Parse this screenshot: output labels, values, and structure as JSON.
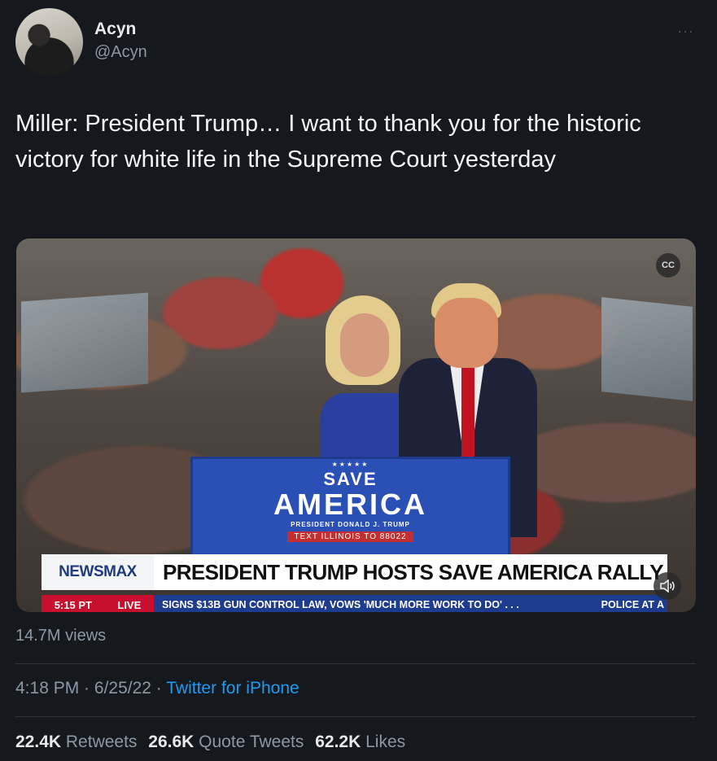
{
  "author": {
    "name": "Acyn",
    "handle": "@Acyn"
  },
  "more_label": "···",
  "tweet_text": "Miller: President Trump… I want to thank you for the historic victory for white life in the Supreme Court yesterday",
  "media": {
    "podium": {
      "stars": "★★★★★",
      "save": "SAVE",
      "america": "AMERICA",
      "subtitle": "PRESIDENT DONALD J. TRUMP",
      "text_line": "TEXT ILLINOIS TO 88022"
    },
    "chyron": {
      "logo": "NEWSMAX",
      "headline": "PRESIDENT TRUMP HOSTS SAVE AMERICA RALLY",
      "time": "5:15 PT",
      "live": "LIVE",
      "ticker": "SIGNS $13B GUN CONTROL LAW, VOWS 'MUCH MORE WORK TO DO' . . .",
      "ticker_right": "POLICE AT A"
    },
    "cc_label": "CC",
    "volume_icon": "speaker-icon"
  },
  "views": "14.7M views",
  "meta": {
    "time": "4:18 PM",
    "sep1": " · ",
    "date": "6/25/22",
    "sep2": " · ",
    "source": "Twitter for iPhone"
  },
  "stats": {
    "retweets_count": "22.4K",
    "retweets_label": "Retweets",
    "quotes_count": "26.6K",
    "quotes_label": "Quote Tweets",
    "likes_count": "62.2K",
    "likes_label": "Likes"
  },
  "colors": {
    "background": "#15181c",
    "link": "#1d9bf0",
    "muted": "#8b98a5"
  }
}
